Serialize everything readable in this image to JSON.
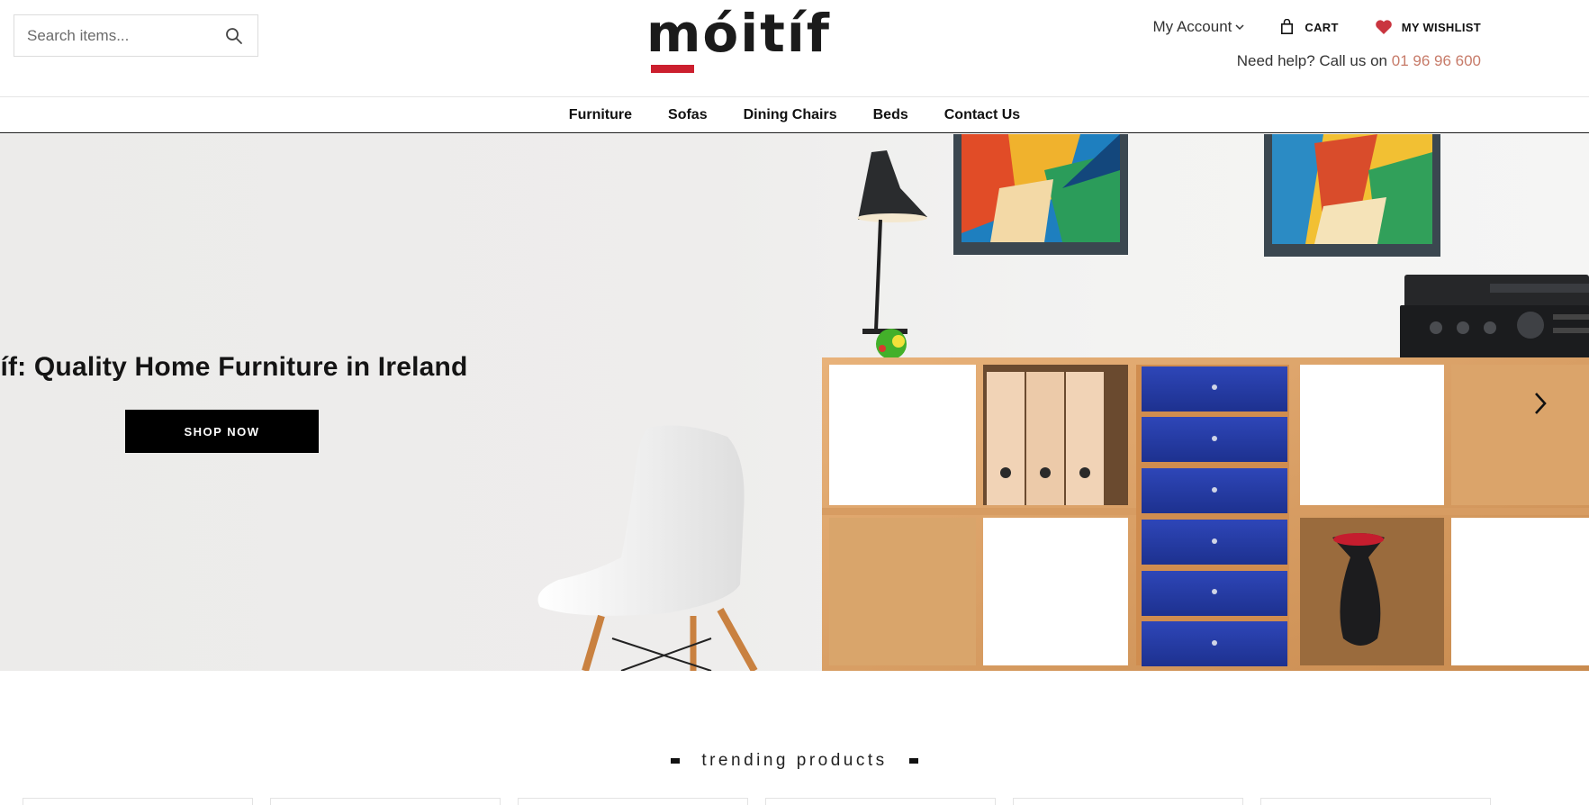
{
  "search": {
    "placeholder": "Search items..."
  },
  "logo": {
    "text": "móitíf"
  },
  "account": {
    "label": "My Account"
  },
  "cart": {
    "label": "CART"
  },
  "wishlist": {
    "label": "MY WISHLIST"
  },
  "help": {
    "text": "Need help? Call us on ",
    "phone": "01 96 96 600"
  },
  "nav": {
    "items": [
      {
        "label": "Furniture"
      },
      {
        "label": "Sofas"
      },
      {
        "label": "Dining Chairs"
      },
      {
        "label": "Beds"
      },
      {
        "label": "Contact Us"
      }
    ]
  },
  "hero": {
    "title": "Móitíf: Quality Home Furniture in Ireland",
    "button": "SHOP NOW"
  },
  "trending": {
    "title": "trending products"
  },
  "colors": {
    "accent_red": "#cc1f2e",
    "phone_color": "#c77b69",
    "wishlist_heart": "#c9353f",
    "nav_text": "#111111"
  },
  "icons": {
    "search": "search-icon",
    "account_dropdown": "chevron-down-icon",
    "cart": "shopping-bag-icon",
    "wishlist": "heart-icon",
    "slider_next": "chevron-right-icon"
  }
}
